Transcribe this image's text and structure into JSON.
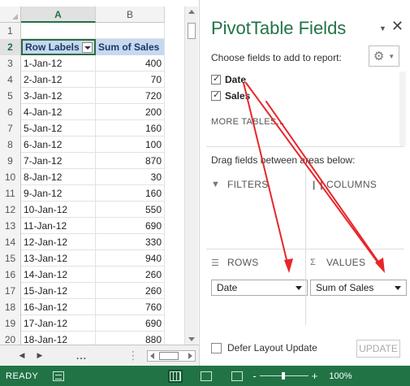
{
  "sheet": {
    "columns": [
      "A",
      "B"
    ],
    "row_numbers": [
      "1",
      "2",
      "3",
      "4",
      "5",
      "6",
      "7",
      "8",
      "9",
      "10",
      "11",
      "12",
      "13",
      "14",
      "15",
      "16",
      "17",
      "18",
      "19",
      "20"
    ],
    "header": {
      "row_labels": "Row Labels",
      "sum_of_sales": "Sum of Sales"
    },
    "rows": [
      {
        "label": "1-Jan-12",
        "value": "400"
      },
      {
        "label": "2-Jan-12",
        "value": "70"
      },
      {
        "label": "3-Jan-12",
        "value": "720"
      },
      {
        "label": "4-Jan-12",
        "value": "200"
      },
      {
        "label": "5-Jan-12",
        "value": "160"
      },
      {
        "label": "6-Jan-12",
        "value": "100"
      },
      {
        "label": "7-Jan-12",
        "value": "870"
      },
      {
        "label": "8-Jan-12",
        "value": "30"
      },
      {
        "label": "9-Jan-12",
        "value": "160"
      },
      {
        "label": "10-Jan-12",
        "value": "550"
      },
      {
        "label": "11-Jan-12",
        "value": "690"
      },
      {
        "label": "12-Jan-12",
        "value": "330"
      },
      {
        "label": "13-Jan-12",
        "value": "940"
      },
      {
        "label": "14-Jan-12",
        "value": "260"
      },
      {
        "label": "15-Jan-12",
        "value": "260"
      },
      {
        "label": "16-Jan-12",
        "value": "760"
      },
      {
        "label": "17-Jan-12",
        "value": "690"
      },
      {
        "label": "18-Jan-12",
        "value": "880"
      }
    ],
    "tabbar": {
      "dots": "..."
    }
  },
  "pivot": {
    "title": "PivotTable Fields",
    "choose_text": "Choose fields to add to report:",
    "fields": [
      {
        "name": "Date",
        "checked": true
      },
      {
        "name": "Sales",
        "checked": true
      }
    ],
    "more_tables": "MORE TABLES...",
    "drag_text": "Drag fields between areas below:",
    "areas": {
      "filters": "FILTERS",
      "columns": "COLUMNS",
      "rows": "ROWS",
      "values": "VALUES",
      "rows_field": "Date",
      "values_field": "Sum of Sales"
    },
    "defer_label": "Defer Layout Update",
    "update_label": "UPDATE"
  },
  "statusbar": {
    "ready": "READY",
    "zoom": "100%",
    "minus": "-",
    "plus": "+"
  },
  "colors": {
    "excel_green": "#217346",
    "header_fill": "#c5d9f1",
    "annotation_red": "#e8262a"
  }
}
